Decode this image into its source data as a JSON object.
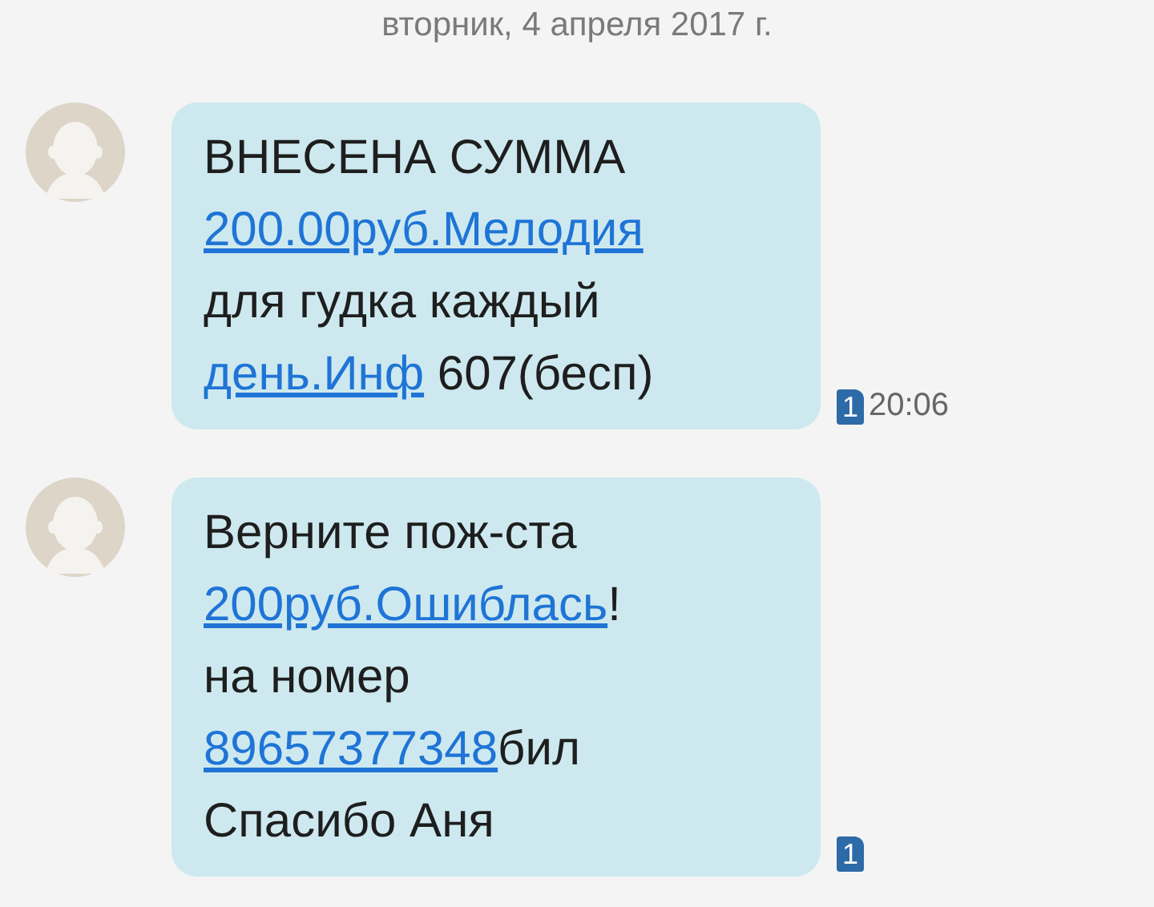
{
  "date_header": "вторник, 4 апреля 2017 г.",
  "messages": [
    {
      "lines": [
        [
          {
            "text": "ВНЕСЕНА СУММА",
            "link": false
          }
        ],
        [
          {
            "text": "200.00руб.Мелодия",
            "link": true
          }
        ],
        [
          {
            "text": "для гудка каждый",
            "link": false
          }
        ],
        [
          {
            "text": "день.Инф",
            "link": true
          },
          {
            "text": " 607(бесп)",
            "link": false
          }
        ]
      ],
      "sim": "1",
      "time": "20:06"
    },
    {
      "lines": [
        [
          {
            "text": "Верните пож-ста",
            "link": false
          }
        ],
        [
          {
            "text": "200руб.Ошиблась",
            "link": true
          },
          {
            "text": "!",
            "link": false
          }
        ],
        [
          {
            "text": "на номер",
            "link": false
          }
        ],
        [
          {
            "text": "89657377348",
            "link": true
          },
          {
            "text": "бил",
            "link": false
          }
        ],
        [
          {
            "text": "Спасибо Аня",
            "link": false
          }
        ]
      ],
      "sim": "1"
    }
  ]
}
